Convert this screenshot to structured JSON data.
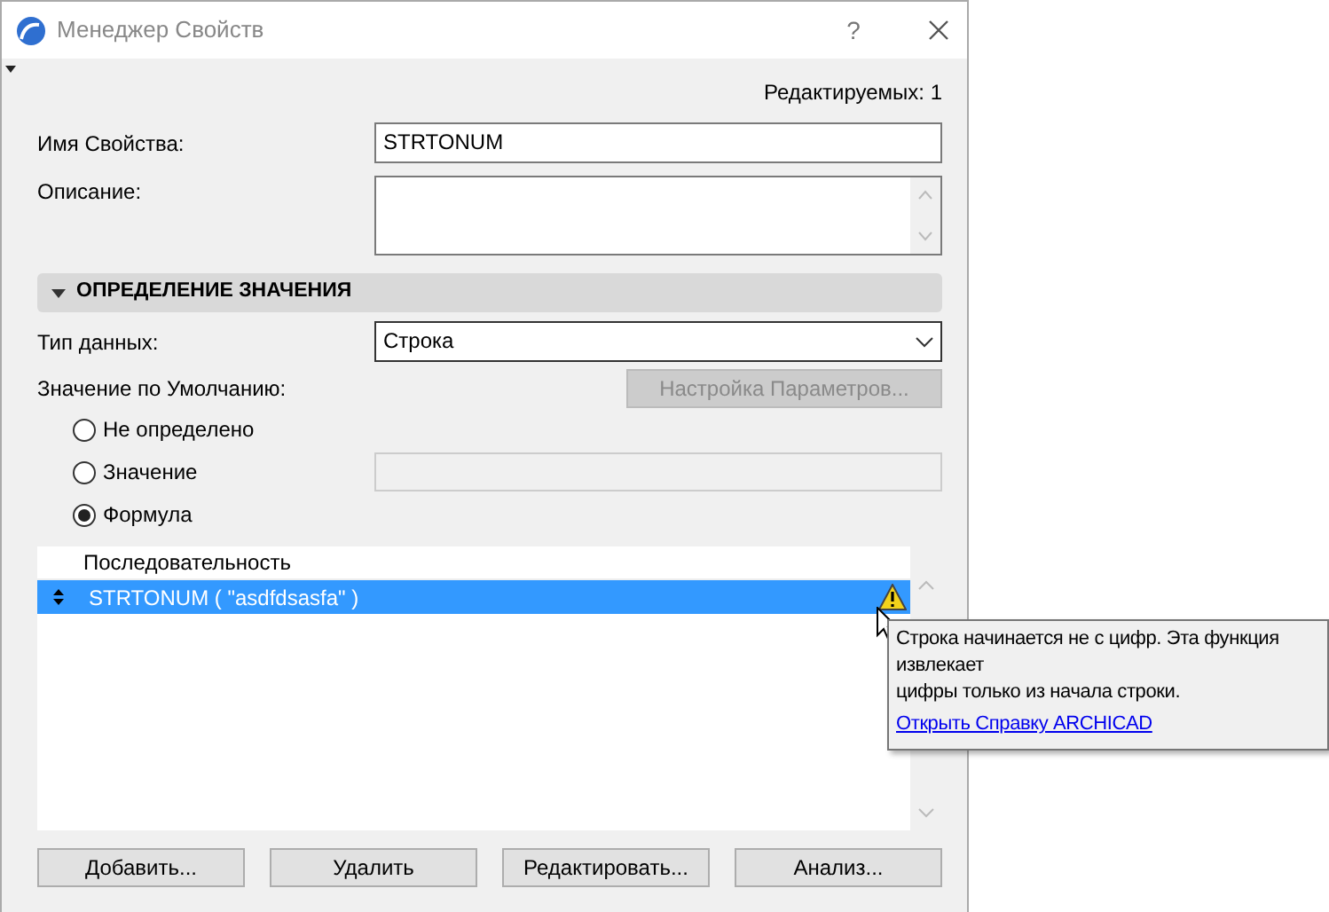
{
  "window": {
    "title": "Менеджер Свойств",
    "help": "?"
  },
  "editable_count": "Редактируемых: 1",
  "property_name": {
    "label": "Имя Свойства:",
    "value": "STRTONUM"
  },
  "description": {
    "label": "Описание:"
  },
  "section": {
    "title": "ОПРЕДЕЛЕНИЕ ЗНАЧЕНИЯ",
    "expanded": true
  },
  "data_type": {
    "label": "Тип данных:",
    "value": "Строка"
  },
  "default_value": {
    "label": "Значение по Умолчанию:",
    "settings_button": {
      "label": "Настройка Параметров...",
      "disabled": true
    },
    "options": [
      {
        "label": "Не определено",
        "selected": false
      },
      {
        "label": "Значение",
        "selected": false,
        "has_field": true
      },
      {
        "label": "Формула",
        "selected": true
      }
    ]
  },
  "sequence": {
    "column": "Последовательность",
    "rows": [
      {
        "text": "STRTONUM ( \"asdfdsasfa\" )",
        "selected": true,
        "warning": true
      }
    ]
  },
  "tooltip": {
    "lines": [
      "Строка начинается не с цифр. Эта функция",
      "извлекает",
      "цифры только из начала строки."
    ],
    "link": "Открыть Справку ARCHICAD"
  },
  "buttons": [
    "Добавить...",
    "Удалить",
    "Редактировать...",
    "Анализ..."
  ]
}
